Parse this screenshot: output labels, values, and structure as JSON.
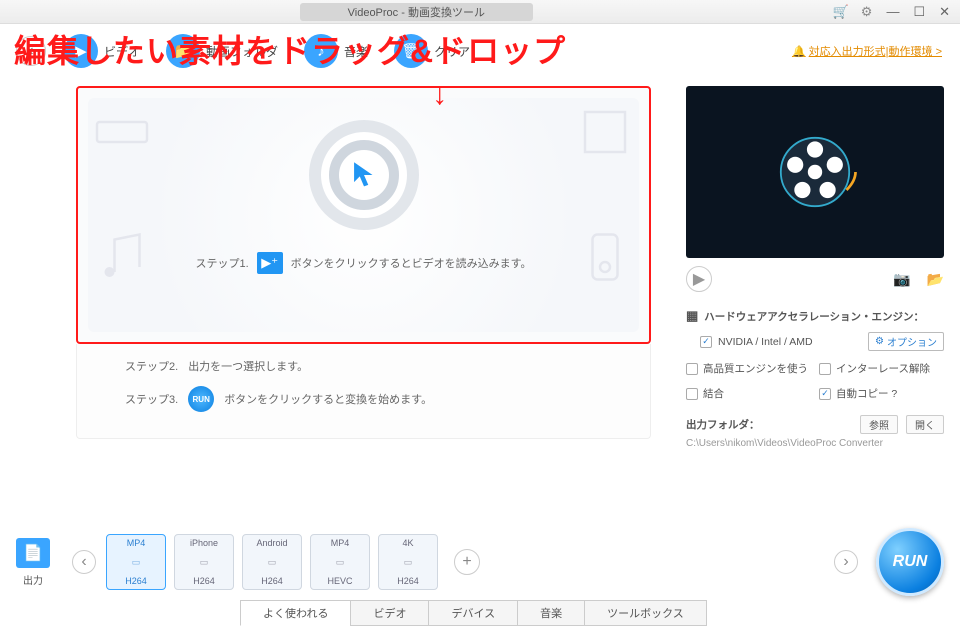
{
  "titlebar": {
    "title": "VideoProc - 動画変換ツール"
  },
  "toolbar": {
    "video": "ビデオ",
    "folder": "動画フォルダ",
    "music": "音楽",
    "screen": "クリア",
    "format_link": "対応入出力形式|動作環境 >"
  },
  "annotation": {
    "text": "編集したい素材をドラッグ&ドロップ",
    "arrow": "↓"
  },
  "dropzone": {
    "step1_label": "ステップ1.",
    "step1_text": "ボタンをクリックするとビデオを読み込みます。"
  },
  "steps": {
    "step2_label": "ステップ2.",
    "step2_text": "出力を一つ選択します。",
    "step3_label": "ステップ3.",
    "step3_text": "ボタンをクリックすると変換を始めます。",
    "run_icon": "RUN"
  },
  "hw": {
    "title": "ハードウェアアクセラレーション・エンジン：",
    "gpu": "NVIDIA / Intel / AMD",
    "option_btn": "オプション",
    "opts": {
      "hq": "高品質エンジンを使う",
      "deint": "インターレース解除",
      "merge": "結合",
      "autocopy": "自動コピー ?"
    }
  },
  "output_folder": {
    "label": "出力フォルダ：",
    "browse": "参照",
    "open": "開く",
    "path": "C:\\Users\\nikom\\Videos\\VideoProc Converter"
  },
  "output_label": "出力",
  "presets": [
    {
      "top": "MP4",
      "bottom": "H264",
      "active": true
    },
    {
      "top": "iPhone",
      "bottom": "H264",
      "active": false
    },
    {
      "top": "Android",
      "bottom": "H264",
      "active": false
    },
    {
      "top": "MP4",
      "bottom": "HEVC",
      "active": false
    },
    {
      "top": "4K",
      "bottom": "H264",
      "active": false
    }
  ],
  "tabs": [
    "よく使われる",
    "ビデオ",
    "デバイス",
    "音楽",
    "ツールボックス"
  ],
  "run_label": "RUN"
}
